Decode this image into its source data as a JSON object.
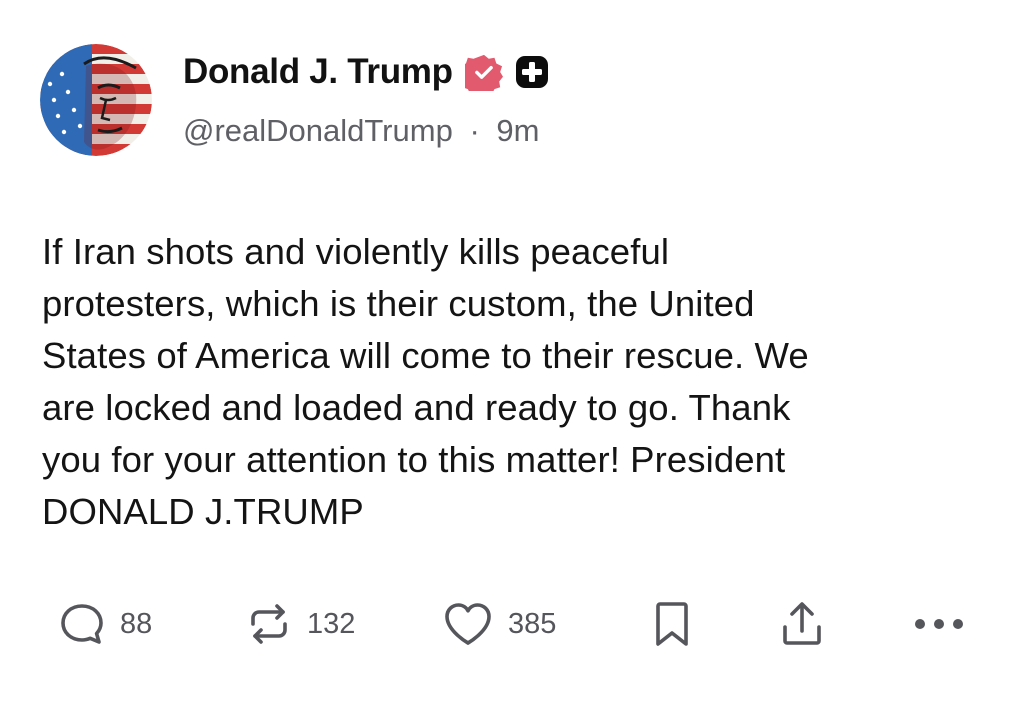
{
  "author": {
    "display_name": "Donald J. Trump",
    "handle": "@realDonaldTrump",
    "separator": "·",
    "time_ago": "9m",
    "verified_badge_color": "#e25a6d",
    "secondary_badge_color": "#0c0c0c"
  },
  "post": {
    "lines": [
      "If Iran shots and violently kills peaceful",
      "protesters, which is their custom, the United",
      "States of America will come to their rescue. We",
      "are locked and loaded and ready to go. Thank",
      "you for your attention to this matter! President",
      "DONALD J.TRUMP"
    ]
  },
  "actions": {
    "reply": {
      "icon": "reply-icon",
      "count": "88"
    },
    "repost": {
      "icon": "repost-icon",
      "count": "132"
    },
    "like": {
      "icon": "heart-icon",
      "count": "385"
    },
    "bookmark": {
      "icon": "bookmark-icon"
    },
    "share": {
      "icon": "share-icon"
    },
    "more": {
      "icon": "more-icon"
    }
  },
  "colors": {
    "icon_gray": "#55555c",
    "text": "#141414",
    "muted": "#5f5f66"
  }
}
